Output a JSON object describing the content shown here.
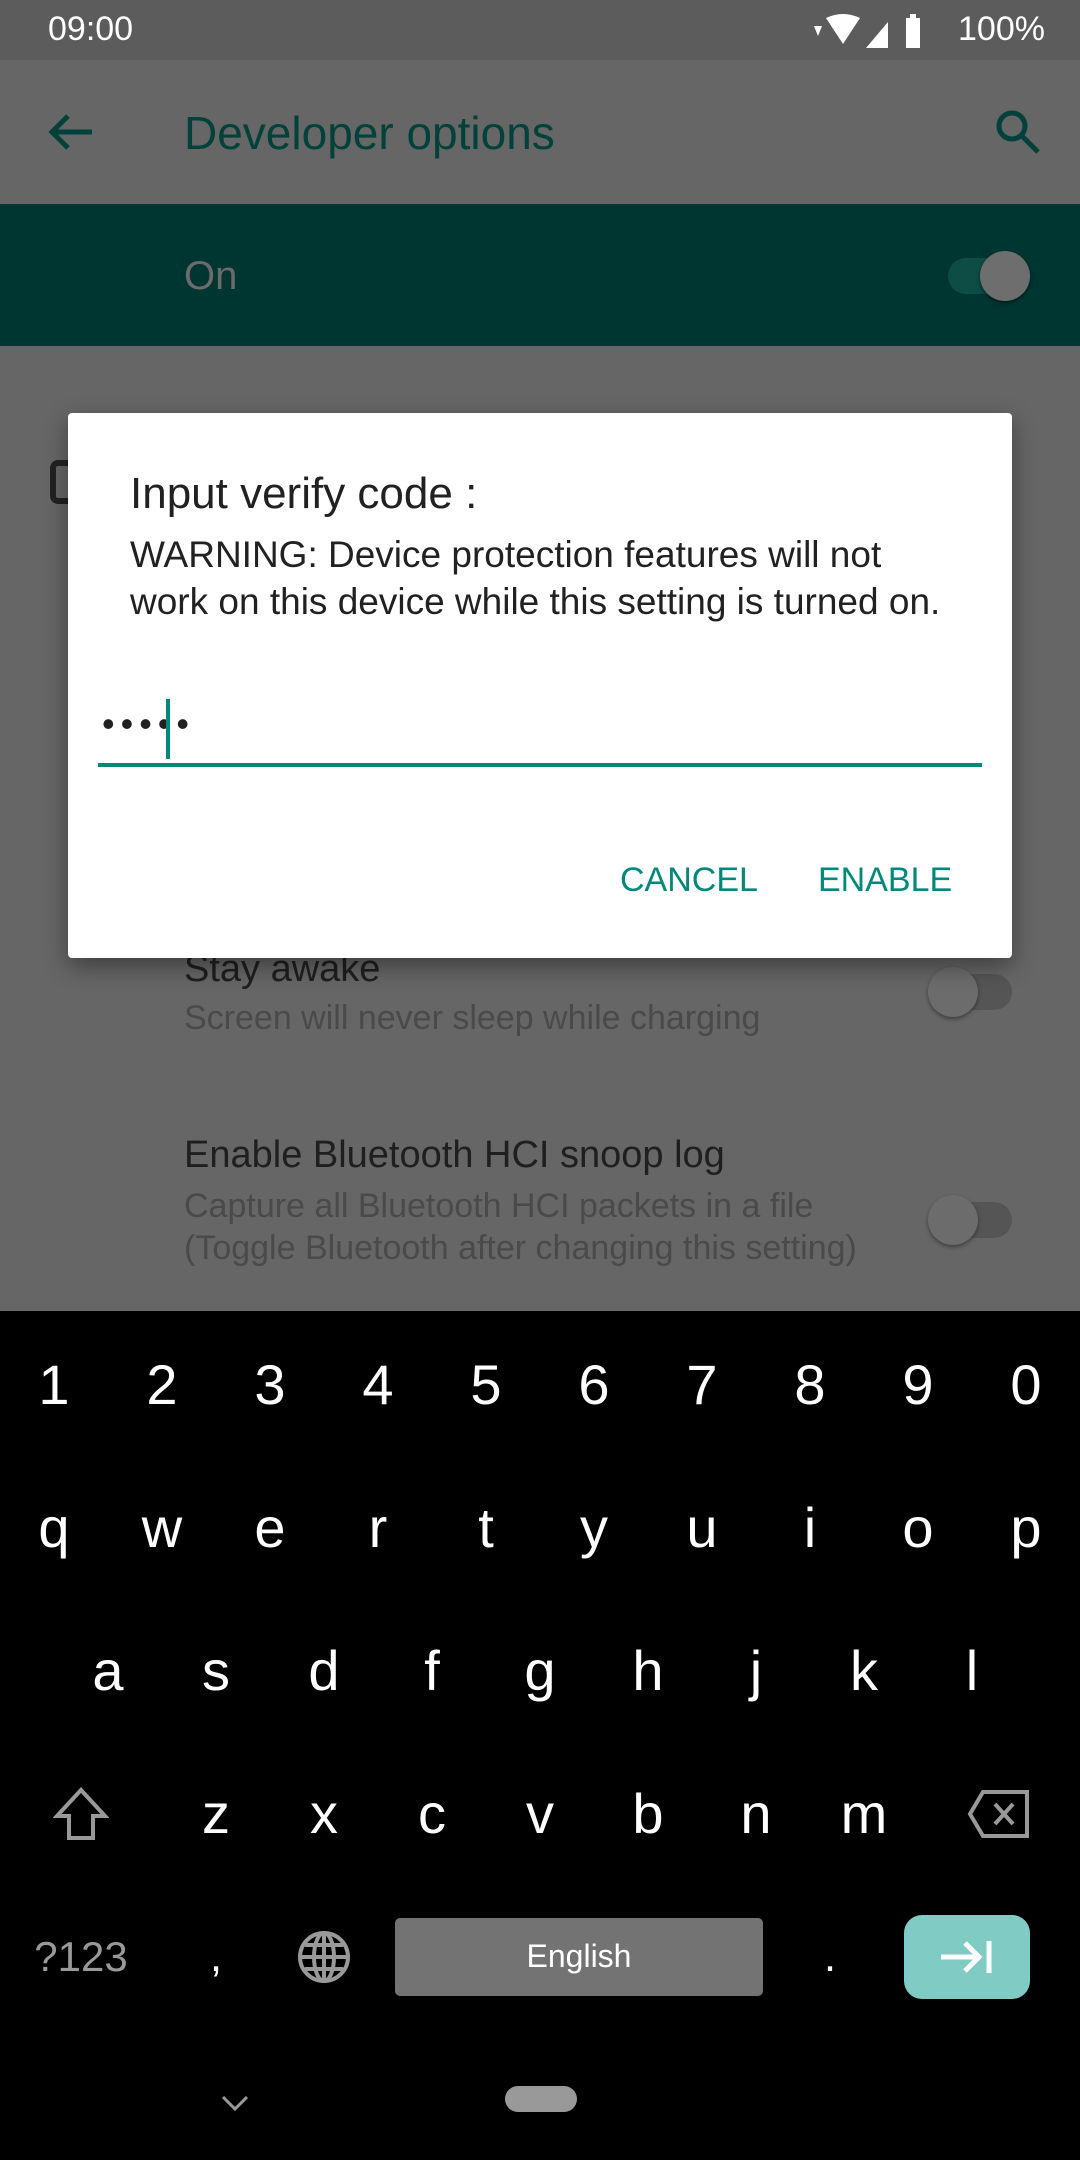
{
  "status_bar": {
    "time": "09:00",
    "battery": "100%"
  },
  "app_bar": {
    "title": "Developer options",
    "back_icon": "arrow-left-icon",
    "search_icon": "search-icon"
  },
  "master_switch": {
    "label": "On",
    "checked": true
  },
  "settings": [
    {
      "title": "Stay awake",
      "subtitle": "Screen will never sleep while charging",
      "checked": false
    },
    {
      "title": "Enable Bluetooth HCI snoop log",
      "subtitle": "Capture all Bluetooth HCI packets in a file (Toggle Bluetooth after changing this setting)",
      "checked": false
    }
  ],
  "dialog": {
    "title": "Input verify code :",
    "message": "WARNING: Device protection features will not work on this device while this setting is turned on.",
    "input_value": "•••••",
    "cancel": "CANCEL",
    "enable": "ENABLE"
  },
  "keyboard": {
    "numbers": [
      "1",
      "2",
      "3",
      "4",
      "5",
      "6",
      "7",
      "8",
      "9",
      "0"
    ],
    "row1": [
      "q",
      "w",
      "e",
      "r",
      "t",
      "y",
      "u",
      "i",
      "o",
      "p"
    ],
    "row2": [
      "a",
      "s",
      "d",
      "f",
      "g",
      "h",
      "j",
      "k",
      "l"
    ],
    "row3": [
      "z",
      "x",
      "c",
      "v",
      "b",
      "n",
      "m"
    ],
    "symbols": "?123",
    "comma": ",",
    "space": "English",
    "period": ".",
    "enter_icon": "tab-next-icon",
    "accent": "#80cbc4"
  },
  "colors": {
    "accent": "#00897b",
    "header_bg": "#003632"
  }
}
